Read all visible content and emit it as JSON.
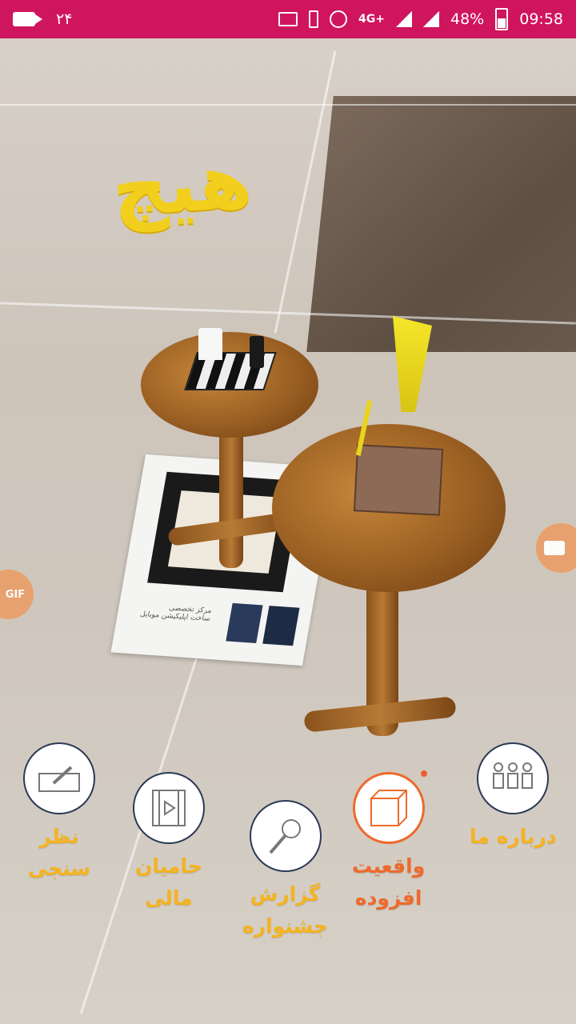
{
  "status_bar": {
    "notification_count": "۲۴",
    "network": "4G+",
    "battery": "48%",
    "time": "09:58",
    "background_color": "#cf155d"
  },
  "ar_scene": {
    "title_text": "هیچ",
    "title_color": "#f2cf1c",
    "paper_text_line1": "مرکز تخصصی",
    "paper_text_line2": "ساخت اپلیکیشن موبایل"
  },
  "side_buttons": {
    "gif_label": "GIF",
    "gif_icon": "gif-camera-icon",
    "video_icon": "video-camera-icon"
  },
  "menu": {
    "items": [
      {
        "label_line1": "نظر",
        "label_line2": "سنجی",
        "icon": "edit-pencil-icon"
      },
      {
        "label_line1": "حامیان",
        "label_line2": "مالی",
        "icon": "video-play-icon"
      },
      {
        "label_line1": "گزارش",
        "label_line2": "جشنواره",
        "icon": "microphone-icon"
      },
      {
        "label_line1": "واقعیت",
        "label_line2": "افزوده",
        "icon": "ar-cube-icon"
      },
      {
        "label_line1": "درباره ما",
        "label_line2": "",
        "icon": "people-group-icon"
      }
    ],
    "label_color": "#f5b31f",
    "active_color": "#ee6a2c"
  }
}
